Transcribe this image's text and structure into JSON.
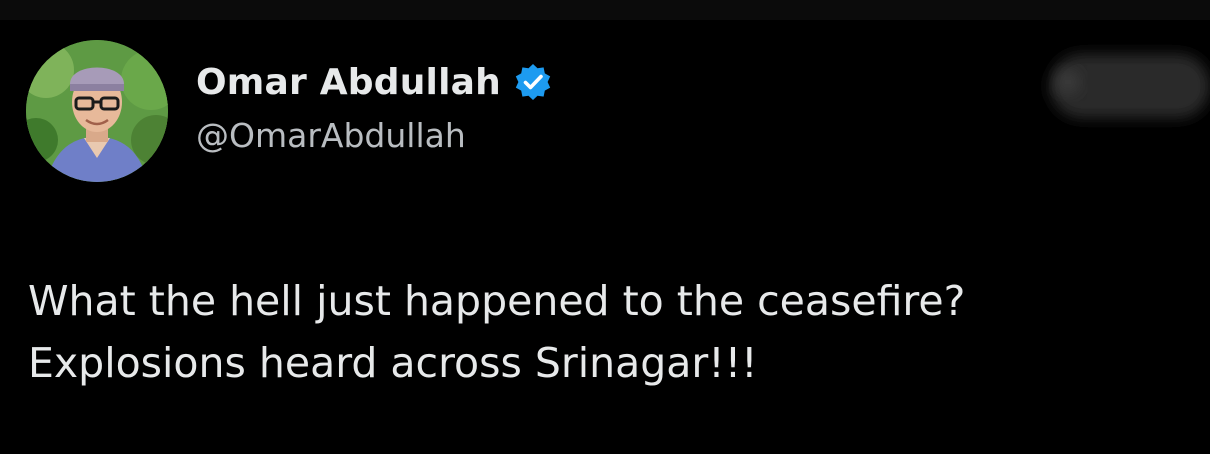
{
  "author": {
    "display_name": "Omar Abdullah",
    "handle": "@OmarAbdullah",
    "verified": true,
    "avatar_icon": "profile-photo",
    "badge_color": "#1d9bf0"
  },
  "tweet": {
    "lines": [
      "What the hell just happened to the ceasefire?",
      "Explosions heard across Srinagar!!!"
    ]
  },
  "colors": {
    "background": "#000000",
    "primary_text": "#e7e9ea",
    "secondary_text": "#b9bdc1"
  }
}
